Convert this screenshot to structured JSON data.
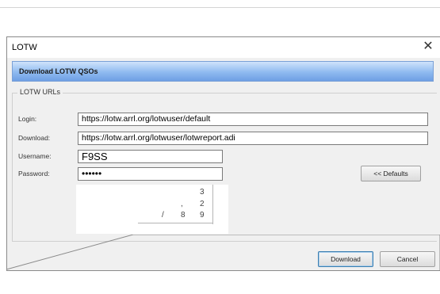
{
  "window": {
    "title": "LOTW",
    "close_glyph": "✕"
  },
  "banner": {
    "title": "Download LOTW QSOs"
  },
  "group": {
    "legend": "LOTW URLs"
  },
  "fields": {
    "login": {
      "label": "Login:",
      "value": "https://lotw.arrl.org/lotwuser/default"
    },
    "download": {
      "label": "Download:",
      "value": "https://lotw.arrl.org/lotwuser/lotwreport.adi"
    },
    "username": {
      "label": "Username:",
      "value": "F9SS"
    },
    "password": {
      "label": "Password:",
      "value": "••••••"
    }
  },
  "buttons": {
    "defaults": "<< Defaults",
    "download": "Download",
    "cancel": "Cancel"
  },
  "overlay": {
    "row1": "3",
    "row2a": ",",
    "row2b": "2",
    "row3a": "/",
    "row3b": "8",
    "row3c": "9"
  },
  "colors": {
    "banner_top": "#cfe3fb",
    "banner_bottom": "#6e9fe4",
    "dialog_bg": "#f0f0f0",
    "focus_border": "#3c7fb1"
  },
  "icons": {
    "close": "close-icon"
  }
}
